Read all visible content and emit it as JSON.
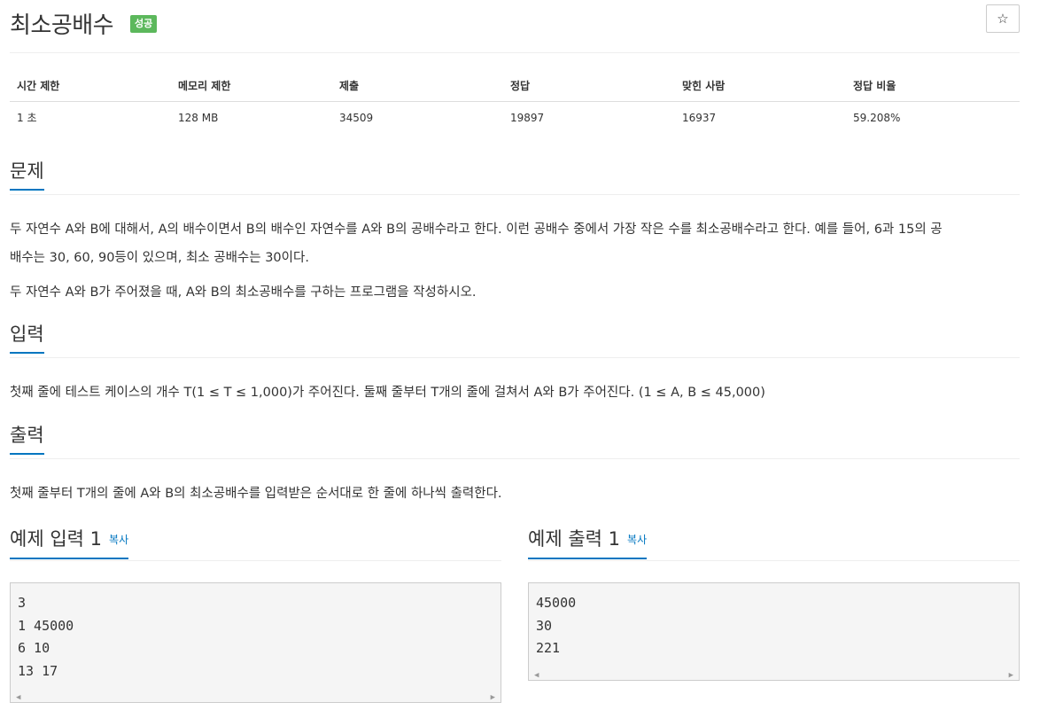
{
  "title": "최소공배수",
  "badge": "성공",
  "stats": {
    "headers": [
      "시간 제한",
      "메모리 제한",
      "제출",
      "정답",
      "맞힌 사람",
      "정답 비율"
    ],
    "values": [
      "1 초",
      "128 MB",
      "34509",
      "19897",
      "16937",
      "59.208%"
    ]
  },
  "problem": {
    "heading": "문제",
    "p1a": "두 자연수 A와 B에 대해서, A의 배수이면서 B의 배수인 자연수를 A와 B의 공배수라고 한다. 이런 공배수 중에서 가장 작은 수를 최소공배수라고 한다. 예를 들어, 6과 15의 공",
    "p1b": "배수는 30, 60, 90등이 있으며, 최소 공배수는 30이다.",
    "p2": "두 자연수 A와 B가 주어졌을 때, A와 B의 최소공배수를 구하는 프로그램을 작성하시오."
  },
  "input": {
    "heading": "입력",
    "text": "첫째 줄에 테스트 케이스의 개수 T(1 ≤ T ≤ 1,000)가 주어진다. 둘째 줄부터 T개의 줄에 걸쳐서 A와 B가 주어진다. (1 ≤ A, B ≤ 45,000)"
  },
  "output": {
    "heading": "출력",
    "text": "첫째 줄부터 T개의 줄에 A와 B의 최소공배수를 입력받은 순서대로 한 줄에 하나씩 출력한다."
  },
  "sample_input": {
    "heading": "예제 입력",
    "number": "1",
    "copy": "복사",
    "lines": [
      "3",
      "1 45000",
      "6 10",
      "13 17"
    ]
  },
  "sample_output": {
    "heading": "예제 출력",
    "number": "1",
    "copy": "복사",
    "lines": [
      "45000",
      "30",
      "221"
    ]
  },
  "icons": {
    "star": "star-icon",
    "scroll_left": "scroll-left-icon",
    "scroll_right": "scroll-right-icon"
  },
  "colors": {
    "accent": "#0076c0",
    "badge": "#5cb85c"
  }
}
